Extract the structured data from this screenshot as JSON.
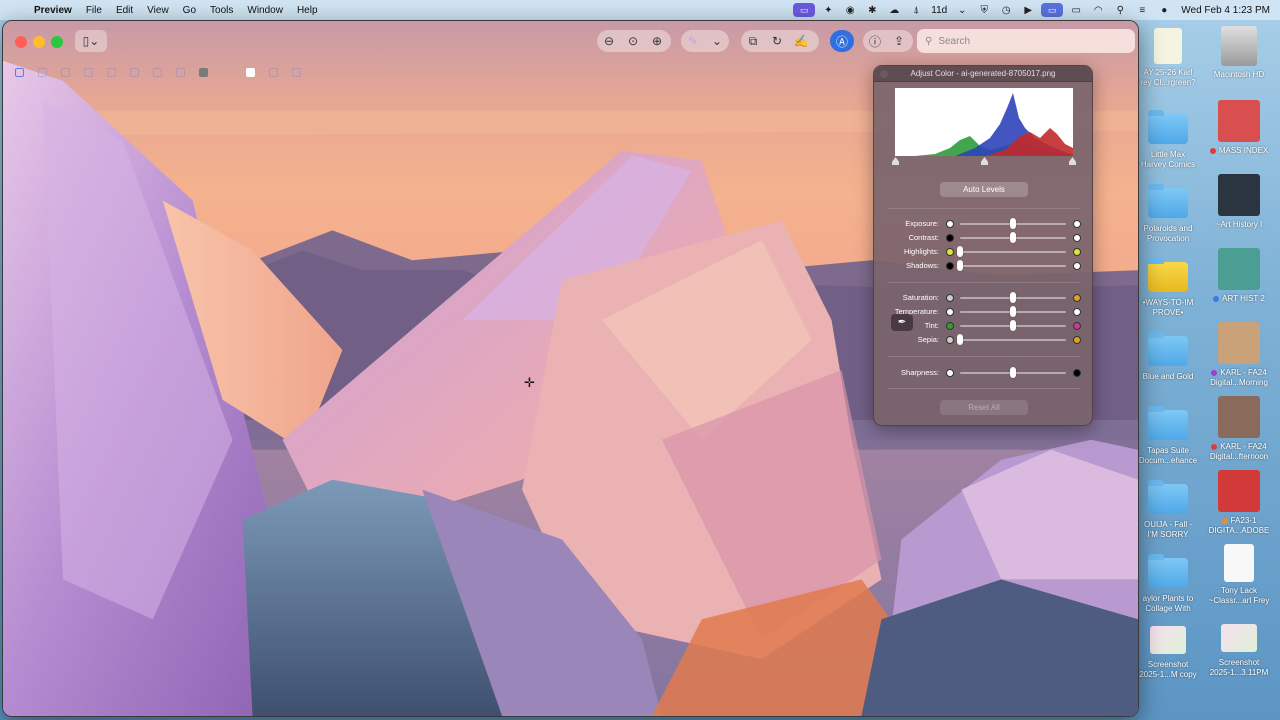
{
  "menubar": {
    "apple": "",
    "app_name": "Preview",
    "menus": [
      "File",
      "Edit",
      "View",
      "Go",
      "Tools",
      "Window",
      "Help"
    ],
    "status_icons": [
      "screen-share-icon",
      "dropbox-icon",
      "camera-icon",
      "figma-icon",
      "creative-cloud-icon",
      "tracking-icon",
      "shield-icon",
      "time-machine-icon",
      "play-icon",
      "control-center-icon",
      "battery-icon",
      "wifi-icon",
      "spotlight-icon",
      "controls-icon",
      "siri-icon"
    ],
    "mac_label": "11d",
    "clock": "Wed Feb 4  1:23 PM"
  },
  "toolbar": {
    "search_placeholder": "Search"
  },
  "adjust_panel": {
    "title": "Adjust Color - ai-generated-8705017.png",
    "auto_levels": "Auto Levels",
    "reset_all": "Reset All",
    "group1": [
      {
        "label": "Exposure:",
        "value": 0.5
      },
      {
        "label": "Contrast:",
        "value": 0.5
      },
      {
        "label": "Highlights:",
        "value": 0.0
      },
      {
        "label": "Shadows:",
        "value": 0.0
      }
    ],
    "group2": [
      {
        "label": "Saturation:",
        "value": 0.5
      },
      {
        "label": "Temperature:",
        "value": 0.5
      },
      {
        "label": "Tint:",
        "value": 0.5
      },
      {
        "label": "Sepia:",
        "value": 0.0
      }
    ],
    "group3": [
      {
        "label": "Sharpness:",
        "value": 0.5
      }
    ]
  },
  "desktop": {
    "col1": [
      {
        "label": "AY 25-26 Karl\nrey Cl...rgreen?",
        "kind": "doc"
      },
      {
        "label": "Little Max\nHarvey Comics",
        "kind": "folder"
      },
      {
        "label": "Polaroids and\nProvocation",
        "kind": "folder"
      },
      {
        "label": "•WAYS-TO-IM\nPROVE•",
        "kind": "folder-yellow"
      },
      {
        "label": "Blue and Gold",
        "kind": "folder"
      },
      {
        "label": "Tapas Suite\nDocum...ehance",
        "kind": "folder"
      },
      {
        "label": "OUIJA - Fall -\nI'M SORRY",
        "kind": "folder"
      },
      {
        "label": "aylor Plants to\nCollage With",
        "kind": "folder"
      },
      {
        "label": "Screenshot\n2025-1...M copy",
        "kind": "screenshot"
      }
    ],
    "col2": [
      {
        "label": "Macintosh HD",
        "kind": "drive",
        "tag": ""
      },
      {
        "label": "MASS INDEX",
        "kind": "image",
        "tag": "#e23a3a"
      },
      {
        "label": "~Art History I",
        "kind": "image",
        "tag": ""
      },
      {
        "label": "ART HIST 2",
        "kind": "image",
        "tag": "#3a7be2"
      },
      {
        "label": "KARL - FA24\nDigital...Morning",
        "kind": "image",
        "tag": "#a33ad8"
      },
      {
        "label": "KARL - FA24\nDigital...fternoon",
        "kind": "image",
        "tag": "#e23a3a"
      },
      {
        "label": "FA23-1\nDIGITA...ADOBE",
        "kind": "image",
        "tag": "#f08a2a"
      },
      {
        "label": "Tony Lack\n~Classr...arl Frey",
        "kind": "doc",
        "tag": ""
      },
      {
        "label": "Screenshot\n2025-1...3.11PM",
        "kind": "screenshot",
        "tag": ""
      }
    ]
  },
  "colors": {
    "accent": "#2f6fe0",
    "close": "#ff5f57",
    "minimize": "#febc2e",
    "zoom": "#28c840"
  }
}
